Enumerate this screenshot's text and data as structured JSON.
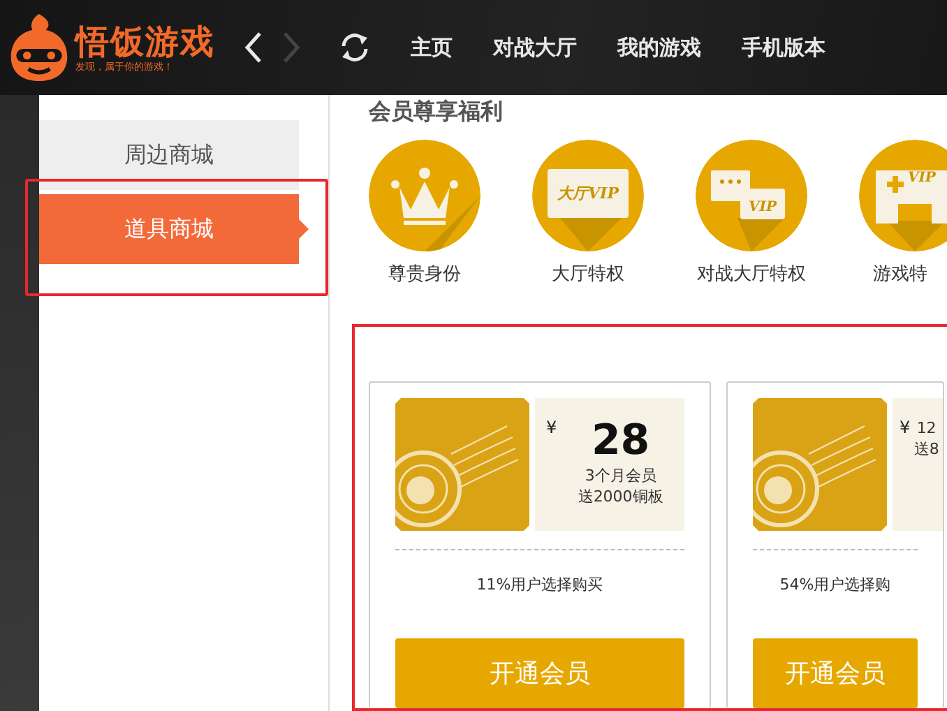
{
  "brand": {
    "name": "悟饭游戏",
    "slogan": "发现，属于你的游戏！"
  },
  "nav": {
    "links": [
      {
        "label": "主页"
      },
      {
        "label": "对战大厅"
      },
      {
        "label": "我的游戏"
      },
      {
        "label": "手机版本"
      }
    ]
  },
  "sidebar": {
    "items": [
      {
        "label": "周边商城",
        "selected": false
      },
      {
        "label": "道具商城",
        "selected": true
      }
    ]
  },
  "section_title": "会员尊享福利",
  "benefits": [
    {
      "label": "尊贵身份",
      "kind": "crown"
    },
    {
      "label": "大厅特权",
      "kind": "hall",
      "badge": "大厅VIP"
    },
    {
      "label": "对战大厅特权",
      "kind": "chat",
      "badge": "VIP"
    },
    {
      "label": "游戏特",
      "kind": "gamepad",
      "badge": "VIP"
    }
  ],
  "plans": [
    {
      "currency": "¥",
      "price": "28",
      "duration": "3个月会员",
      "bonus": "送2000铜板",
      "share": "11%用户选择购买",
      "button": "开通会员"
    },
    {
      "currency": "¥",
      "duration": "12",
      "bonus": "送8",
      "share": "54%用户选择购",
      "button": "开通会员"
    }
  ]
}
